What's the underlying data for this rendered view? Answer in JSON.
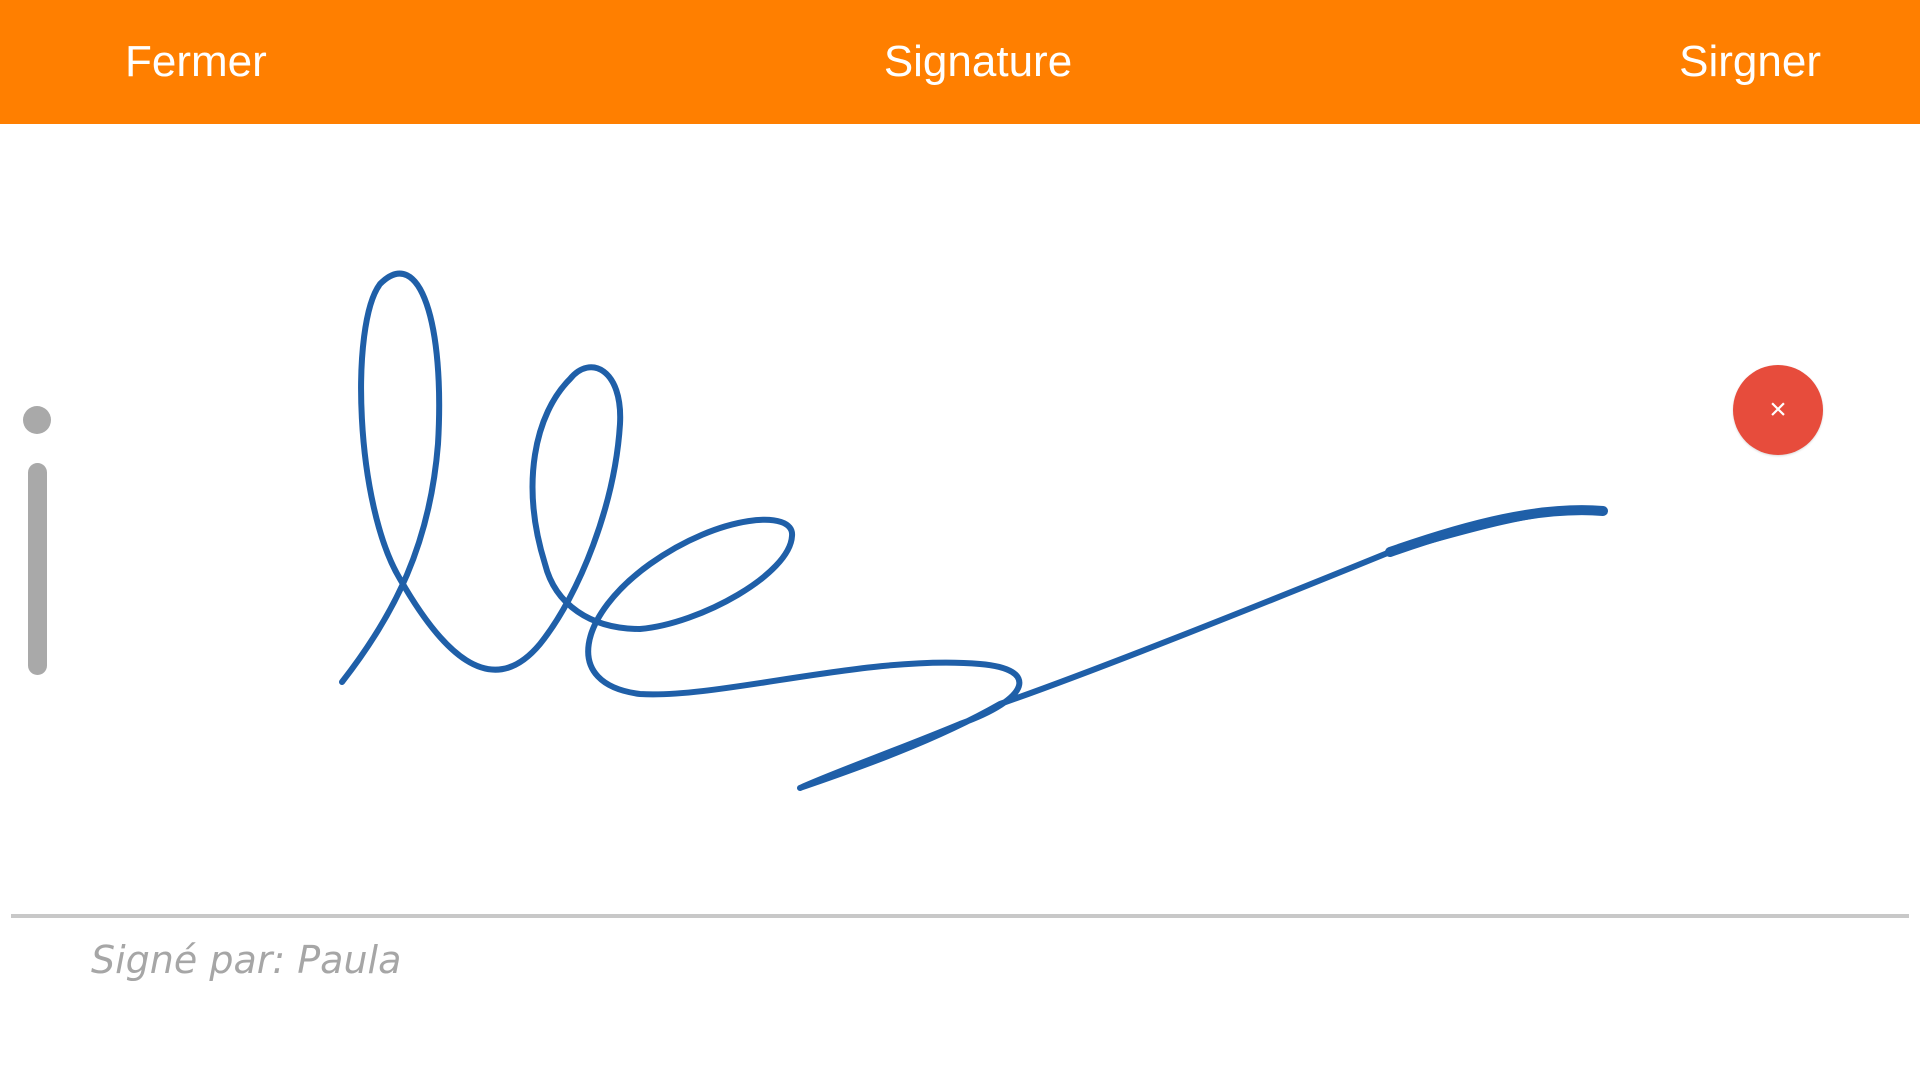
{
  "header": {
    "close_label": "Fermer",
    "title": "Signature",
    "sign_label": "Sirgner",
    "background_color": "#ff7f00",
    "text_color": "#ffffff"
  },
  "signature_pad": {
    "clear_icon": "close-icon",
    "clear_symbol": "×",
    "clear_button_color": "#e74c3c",
    "ink_color": "#1f5fa8"
  },
  "footer": {
    "signed_by_text": "Signé par: Paula"
  }
}
